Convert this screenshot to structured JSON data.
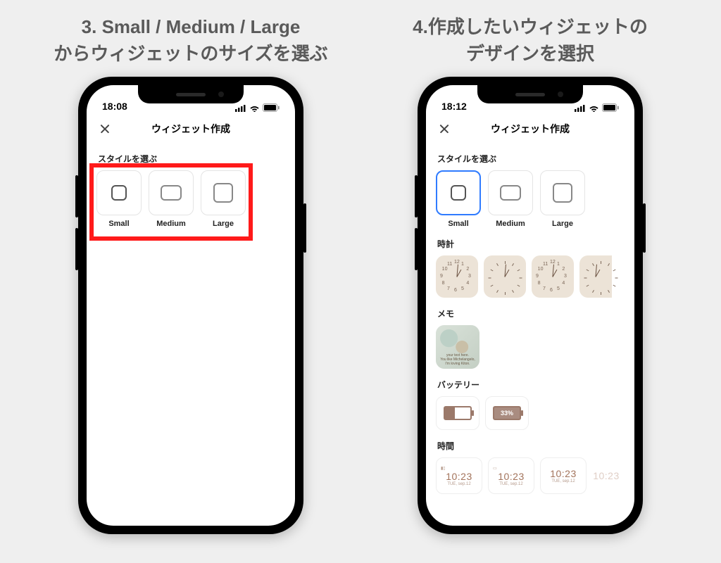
{
  "left": {
    "caption": "3. Small / Medium / Large\nからウィジェットのサイズを選ぶ",
    "status_time": "18:08",
    "screen_title": "ウィジェット作成",
    "section_style": "スタイルを選ぶ",
    "styles": {
      "small": "Small",
      "medium": "Medium",
      "large": "Large"
    }
  },
  "right": {
    "caption": "4.作成したいウィジェットの\nデザインを選択",
    "status_time": "18:12",
    "screen_title": "ウィジェット作成",
    "section_style": "スタイルを選ぶ",
    "styles": {
      "small": "Small",
      "medium": "Medium",
      "large": "Large"
    },
    "section_clock": "時計",
    "section_memo": "メモ",
    "memo_lines": [
      "your text here.",
      "You like Michelangelo,",
      "I'm loving Kiton."
    ],
    "section_battery": "バッテリー",
    "battery_pct": "33%",
    "section_time": "時間",
    "time_value": "10:23",
    "time_date": "TUE, sep.12"
  },
  "clock_numbers": [
    "12",
    "1",
    "2",
    "3",
    "4",
    "5",
    "6",
    "7",
    "8",
    "9",
    "10",
    "11"
  ]
}
